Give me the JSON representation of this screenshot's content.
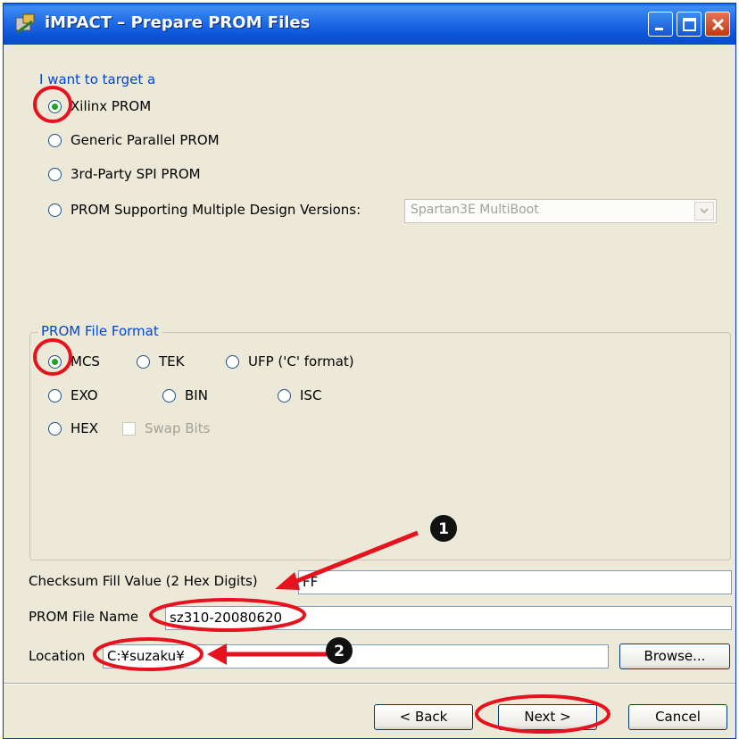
{
  "window": {
    "title": "iMPACT – Prepare PROM Files"
  },
  "target": {
    "heading": "I want to target a",
    "options": [
      {
        "label": "Xilinx PROM",
        "selected": true
      },
      {
        "label": "Generic Parallel PROM",
        "selected": false
      },
      {
        "label": "3rd-Party SPI PROM",
        "selected": false
      },
      {
        "label": "PROM Supporting Multiple Design Versions:",
        "selected": false
      }
    ],
    "multiboot_select": {
      "value": "Spartan3E MultiBoot",
      "enabled": false
    }
  },
  "format": {
    "heading": "PROM File Format",
    "options": [
      {
        "label": "MCS",
        "selected": true
      },
      {
        "label": "TEK",
        "selected": false
      },
      {
        "label": "UFP ('C' format)",
        "selected": false
      },
      {
        "label": "EXO",
        "selected": false
      },
      {
        "label": "BIN",
        "selected": false
      },
      {
        "label": "ISC",
        "selected": false
      },
      {
        "label": "HEX",
        "selected": false
      }
    ],
    "swap_bits": {
      "label": "Swap Bits",
      "checked": false,
      "enabled": false
    }
  },
  "fields": {
    "checksum": {
      "label": "Checksum Fill Value (2 Hex Digits)",
      "value": "FF"
    },
    "file_name": {
      "label": "PROM File Name",
      "value": "sz310-20080620"
    },
    "location": {
      "label": "Location",
      "value": "C:¥suzaku¥"
    }
  },
  "buttons": {
    "browse": "Browse...",
    "back": "< Back",
    "next": "Next >",
    "cancel": "Cancel"
  },
  "annotations": {
    "marker1": "1",
    "marker2": "2"
  },
  "colors": {
    "annotation_red": "#e8121e",
    "title_blue": "#0a5ee4",
    "radio_green": "#21a121",
    "label_blue": "#0046d5"
  }
}
